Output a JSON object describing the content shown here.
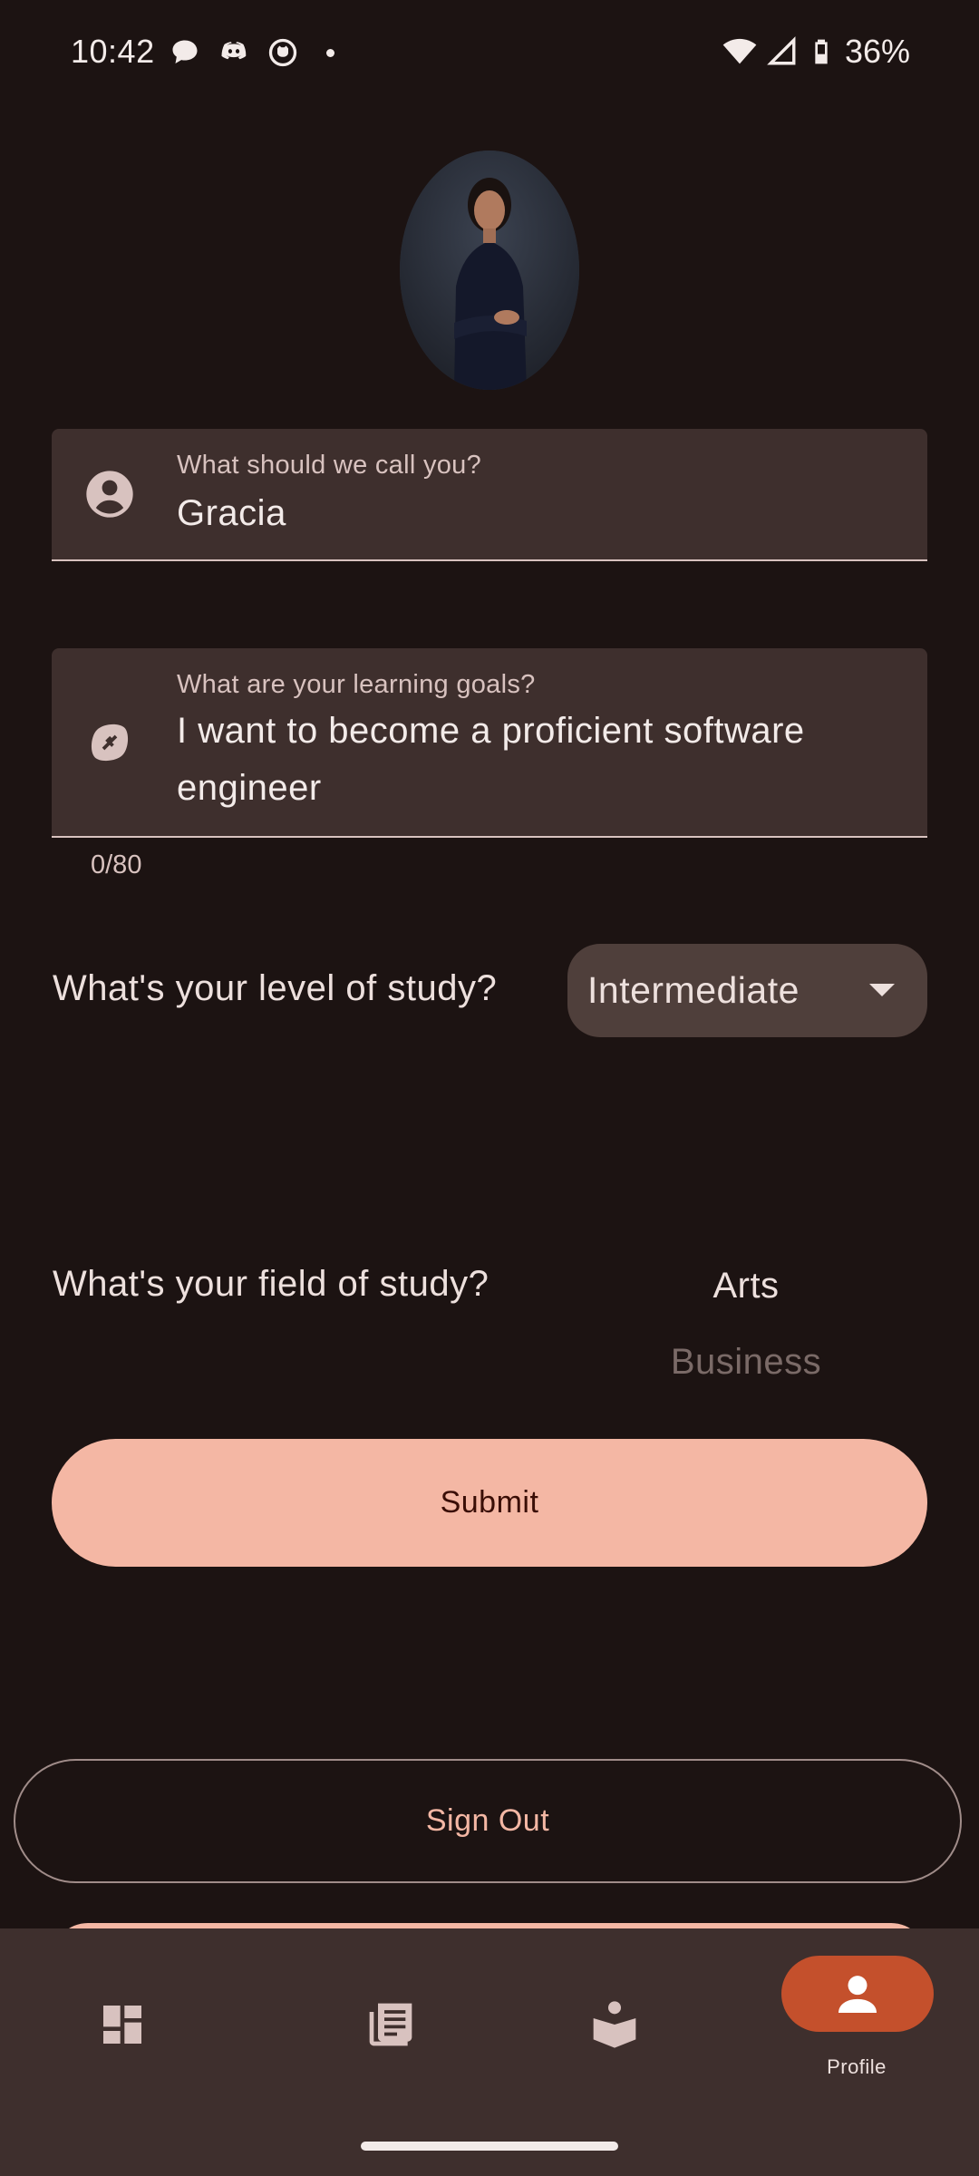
{
  "status_bar": {
    "time": "10:42",
    "battery": "36%",
    "icons": [
      "chat-bubble-icon",
      "discord-icon",
      "github-icon",
      "notification-dot",
      "wifi-icon",
      "signal-icon",
      "battery-icon"
    ]
  },
  "profile": {
    "avatar": "user-photo"
  },
  "name_field": {
    "label": "What should we call you?",
    "value": "Gracia",
    "icon": "account-circle-icon"
  },
  "goals_field": {
    "label": "What are your learning goals?",
    "value": "I want to become a proficient software engineer",
    "counter": "0/80",
    "icon": "football-icon"
  },
  "level": {
    "question": "What's your level of study?",
    "selected": "Intermediate"
  },
  "field_of_study": {
    "question": "What's your field of study?",
    "selected": "Arts",
    "next_option": "Business"
  },
  "actions": {
    "submit": "Submit",
    "sign_out": "Sign Out"
  },
  "bottom_nav": {
    "items": [
      {
        "icon": "dashboard-icon",
        "label": ""
      },
      {
        "icon": "newspaper-icon",
        "label": ""
      },
      {
        "icon": "book-reader-icon",
        "label": ""
      },
      {
        "icon": "person-icon",
        "label": "Profile",
        "active": true
      }
    ]
  },
  "colors": {
    "background": "#1c1312",
    "surface": "#3e2f2d",
    "primary": "#f4b7a4",
    "active_nav": "#c4502c"
  }
}
